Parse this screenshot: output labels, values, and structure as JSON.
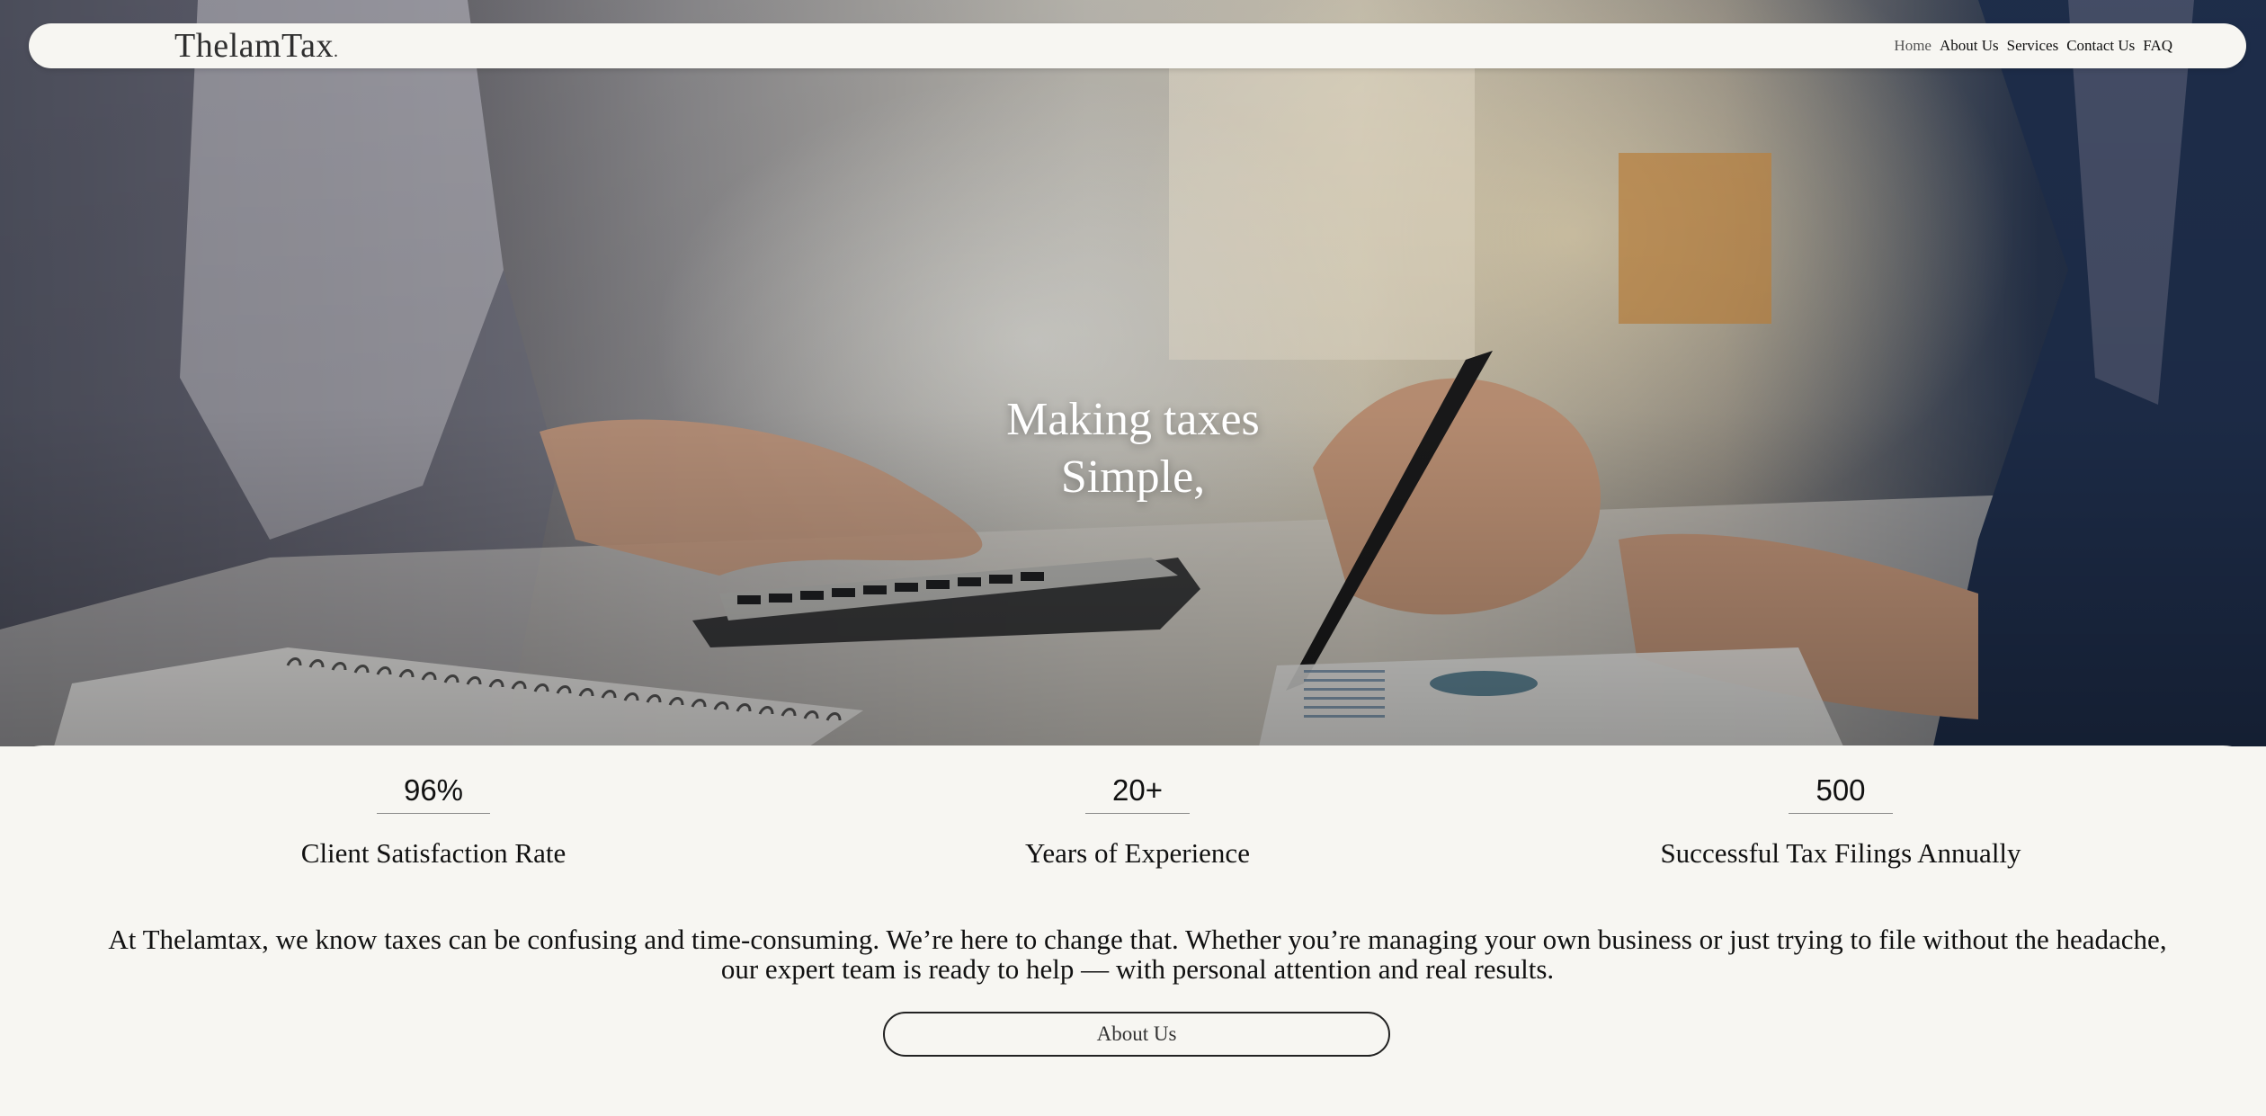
{
  "header": {
    "logo_text": "ThelamTax",
    "logo_suffix": ".",
    "nav": [
      {
        "label": "Home",
        "active": true
      },
      {
        "label": "About Us",
        "active": false
      },
      {
        "label": "Services",
        "active": false
      },
      {
        "label": "Contact Us",
        "active": false
      },
      {
        "label": "FAQ",
        "active": false
      }
    ]
  },
  "hero": {
    "title_line1": "Making taxes",
    "title_line2": "Simple,"
  },
  "stats": [
    {
      "value": "96%",
      "label": "Client Satisfaction Rate"
    },
    {
      "value": "20+",
      "label": "Years of Experience"
    },
    {
      "value": "500",
      "label": "Successful Tax Filings Annually"
    }
  ],
  "intro": {
    "text": "At Thelamtax, we know taxes can be confusing and time-consuming. We’re here to change that. Whether you’re managing your own business or just trying to file without the headache, our expert team is ready to help — with personal attention and real results."
  },
  "cta": {
    "about_label": "About Us"
  },
  "colors": {
    "background": "#f7f6f2",
    "text": "#111111",
    "hero_text": "#ffffff"
  }
}
